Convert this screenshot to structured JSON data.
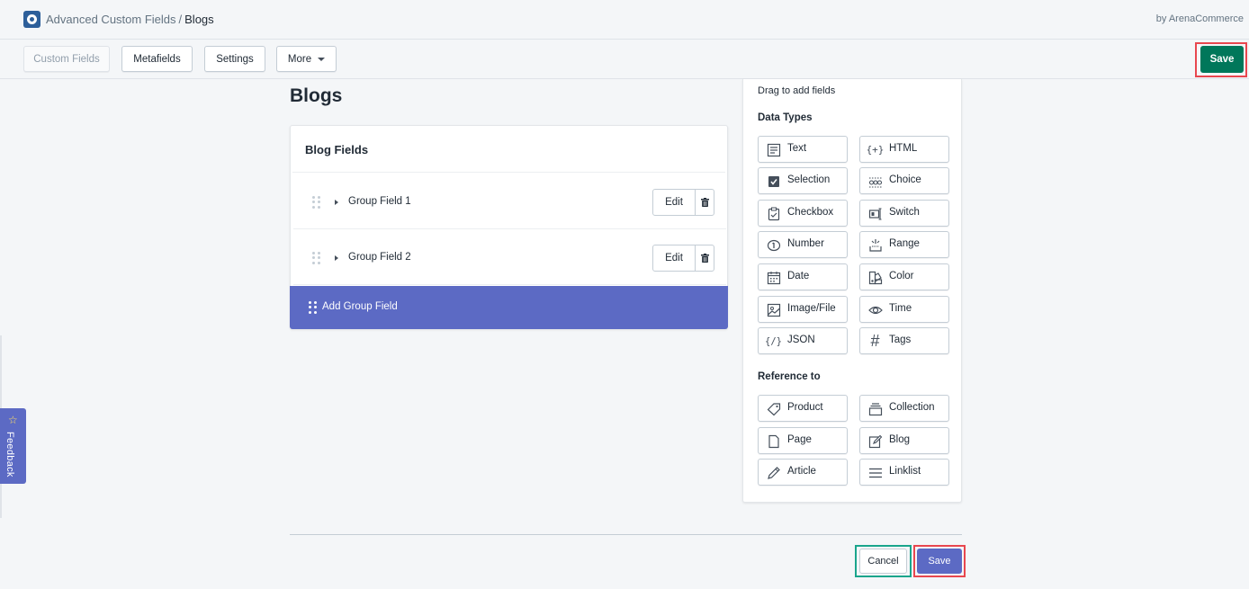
{
  "header": {
    "app_name": "Advanced Custom Fields",
    "separator": "/",
    "current_page": "Blogs",
    "byline": "by ArenaCommerce"
  },
  "toolbar": {
    "custom_fields": "Custom Fields",
    "metafields": "Metafields",
    "settings": "Settings",
    "more": "More",
    "save": "Save"
  },
  "main": {
    "title": "Blogs",
    "card_title": "Blog Fields",
    "groups": [
      {
        "name": "Group Field 1",
        "edit": "Edit"
      },
      {
        "name": "Group Field 2",
        "edit": "Edit"
      }
    ],
    "add_group": "Add Group Field"
  },
  "panel": {
    "hint": "Drag to add fields",
    "data_types_heading": "Data Types",
    "data_types": [
      {
        "label": "Text",
        "icon": "text-icon"
      },
      {
        "label": "HTML",
        "icon": "html-icon"
      },
      {
        "label": "Selection",
        "icon": "selection-icon"
      },
      {
        "label": "Choice",
        "icon": "choice-icon"
      },
      {
        "label": "Checkbox",
        "icon": "checkbox-icon"
      },
      {
        "label": "Switch",
        "icon": "switch-icon"
      },
      {
        "label": "Number",
        "icon": "number-icon"
      },
      {
        "label": "Range",
        "icon": "range-icon"
      },
      {
        "label": "Date",
        "icon": "date-icon"
      },
      {
        "label": "Color",
        "icon": "color-icon"
      },
      {
        "label": "Image/File",
        "icon": "image-icon"
      },
      {
        "label": "Time",
        "icon": "time-icon"
      },
      {
        "label": "JSON",
        "icon": "json-icon"
      },
      {
        "label": "Tags",
        "icon": "tags-icon"
      }
    ],
    "reference_heading": "Reference to",
    "references": [
      {
        "label": "Product",
        "icon": "product-icon"
      },
      {
        "label": "Collection",
        "icon": "collection-icon"
      },
      {
        "label": "Page",
        "icon": "page-icon"
      },
      {
        "label": "Blog",
        "icon": "blog-icon"
      },
      {
        "label": "Article",
        "icon": "article-icon"
      },
      {
        "label": "Linklist",
        "icon": "linklist-icon"
      }
    ]
  },
  "footer": {
    "cancel": "Cancel",
    "save": "Save"
  },
  "feedback": {
    "label": "Feedback"
  },
  "colors": {
    "primary_save": "#00775a",
    "accent": "#5c6ac4",
    "highlight_red": "#e8474f",
    "highlight_green": "#1aa58c"
  }
}
